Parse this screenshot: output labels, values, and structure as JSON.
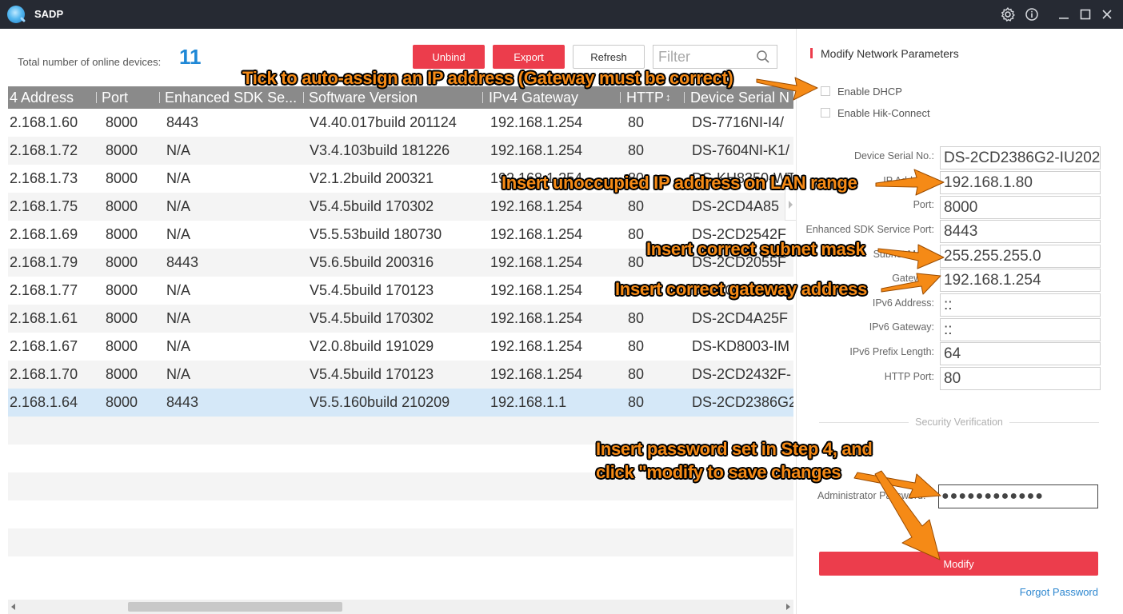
{
  "app": {
    "title": "SADP",
    "window_controls": [
      "gear-icon",
      "info-icon",
      "minimize-icon",
      "maximize-icon",
      "close-icon"
    ]
  },
  "toolbar": {
    "total_label": "Total number of online devices:",
    "total_count": "11",
    "unbind_label": "Unbind",
    "export_label": "Export",
    "refresh_label": "Refresh",
    "filter_placeholder": "Filter"
  },
  "table": {
    "headers": [
      "4 Address",
      "Port",
      "Enhanced SDK Se...",
      "Software Version",
      "IPv4 Gateway",
      "HTTP",
      "Device Serial N"
    ],
    "sort_indicator": "↕",
    "rows": [
      [
        "2.168.1.60",
        "8000",
        "8443",
        "V4.40.017build 201124",
        "192.168.1.254",
        "80",
        "DS-7716NI-I4/"
      ],
      [
        "2.168.1.72",
        "8000",
        "N/A",
        "V3.4.103build 181226",
        "192.168.1.254",
        "80",
        "DS-7604NI-K1/"
      ],
      [
        "2.168.1.73",
        "8000",
        "N/A",
        "V2.1.2build 200321",
        "192.168.1.254",
        "80",
        "DS-KH8350-WT"
      ],
      [
        "2.168.1.75",
        "8000",
        "N/A",
        "V5.4.5build 170302",
        "192.168.1.254",
        "80",
        "DS-2CD4A85"
      ],
      [
        "2.168.1.69",
        "8000",
        "N/A",
        "V5.5.53build 180730",
        "192.168.1.254",
        "80",
        "DS-2CD2542F"
      ],
      [
        "2.168.1.79",
        "8000",
        "8443",
        "V5.6.5build 200316",
        "192.168.1.254",
        "80",
        "DS-2CD2055F"
      ],
      [
        "2.168.1.77",
        "8000",
        "N/A",
        "V5.4.5build 170123",
        "192.168.1.254",
        "80",
        "DS-2CD2"
      ],
      [
        "2.168.1.61",
        "8000",
        "N/A",
        "V5.4.5build 170302",
        "192.168.1.254",
        "80",
        "DS-2CD4A25F"
      ],
      [
        "2.168.1.67",
        "8000",
        "N/A",
        "V2.0.8build 191029",
        "192.168.1.254",
        "80",
        "DS-KD8003-IM"
      ],
      [
        "2.168.1.70",
        "8000",
        "N/A",
        "V5.4.5build 170123",
        "192.168.1.254",
        "80",
        "DS-2CD2432F-"
      ],
      [
        "2.168.1.64",
        "8000",
        "8443",
        "V5.5.160build 210209",
        "192.168.1.1",
        "80",
        "DS-2CD2386G2"
      ]
    ],
    "selected_row": 10
  },
  "panel": {
    "title": "Modify Network Parameters",
    "enable_dhcp": "Enable DHCP",
    "enable_hik_connect": "Enable Hik-Connect",
    "fields": [
      {
        "label": "Device Serial No.:",
        "value": "DS-2CD2386G2-IU202"
      },
      {
        "label": "IP Address:",
        "value": "192.168.1.80"
      },
      {
        "label": "Port:",
        "value": "8000"
      },
      {
        "label": "Enhanced SDK Service Port:",
        "value": "8443"
      },
      {
        "label": "Subnet Mask:",
        "value": "255.255.255.0"
      },
      {
        "label": "Gateway:",
        "value": "192.168.1.254"
      },
      {
        "label": "IPv6 Address:",
        "value": "::"
      },
      {
        "label": "IPv6 Gateway:",
        "value": "::"
      },
      {
        "label": "IPv6 Prefix Length:",
        "value": "64"
      },
      {
        "label": "HTTP Port:",
        "value": "80"
      }
    ],
    "security_title": "Security Verification",
    "password_label": "Administrator Password:",
    "password_value": "●●●●●●●●●●●●",
    "modify_label": "Modify",
    "forgot_label": "Forgot Password"
  },
  "annotations": {
    "dhcp_tip": "Tick to auto-assign an IP address (Gateway must be correct)",
    "ip_tip": "Insert unoccupied IP address on LAN range",
    "mask_tip": "Insert correct subnet mask",
    "gateway_tip": "Insert correct gateway address",
    "password_tip_line1": "Insert password set in Step 4, and",
    "password_tip_line2": "click \"modify to save changes",
    "accent_color": "#f58a16"
  }
}
